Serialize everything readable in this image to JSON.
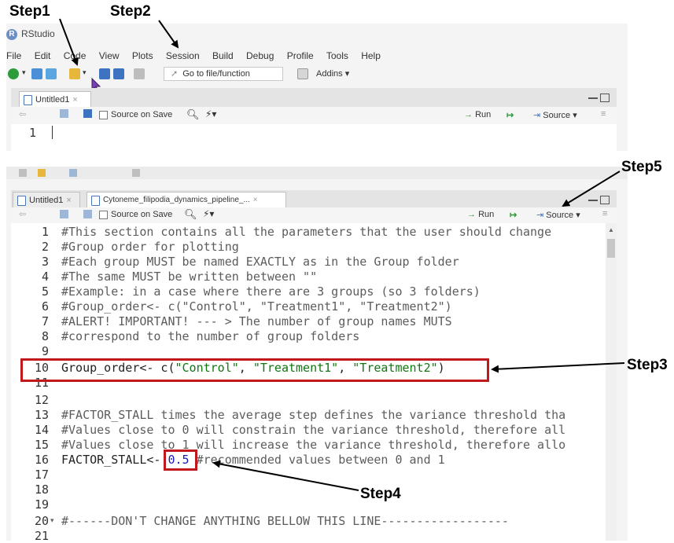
{
  "annotations": {
    "step1": "Step1",
    "step2": "Step2",
    "step3": "Step3",
    "step4": "Step4",
    "step5": "Step5"
  },
  "top_window": {
    "app_title": "RStudio",
    "menu": [
      "File",
      "Edit",
      "Code",
      "View",
      "Plots",
      "Session",
      "Build",
      "Debug",
      "Profile",
      "Tools",
      "Help"
    ],
    "goto_label": "Go to file/function",
    "addins_label": "Addins",
    "tab_label": "Untitled1",
    "source_on_save": "Source on Save",
    "run_label": "Run",
    "source_label": "Source",
    "line_number": "1"
  },
  "bottom_window": {
    "tabs": [
      {
        "label": "Untitled1"
      },
      {
        "label": "Cytoneme_filipodia_dynamics_pipeline_..."
      }
    ],
    "source_on_save": "Source on Save",
    "run_label": "Run",
    "source_label": "Source",
    "lines": [
      {
        "n": "1",
        "text": "#This section contains all the parameters that the user should change",
        "kind": "comment"
      },
      {
        "n": "2",
        "text": "#Group order for plotting",
        "kind": "comment"
      },
      {
        "n": "3",
        "text": "#Each group MUST be named EXACTLY as in the Group folder",
        "kind": "comment"
      },
      {
        "n": "4",
        "text": "#The same MUST be written between \"\"",
        "kind": "comment"
      },
      {
        "n": "5",
        "text": "#Example: in a case where there are 3 groups (so 3 folders)",
        "kind": "comment"
      },
      {
        "n": "6",
        "text": "#Group_order<- c(\"Control\", \"Treatment1\", \"Treatment2\")",
        "kind": "comment"
      },
      {
        "n": "7",
        "text": "#ALERT! IMPORTANT! --- > The number of group names MUTS",
        "kind": "comment"
      },
      {
        "n": "8",
        "text": "#correspond to the number of group folders",
        "kind": "comment"
      },
      {
        "n": "9",
        "text": "",
        "kind": "comment"
      },
      {
        "n": "10",
        "text": "Group_order<- c(\"Control\", \"Treatment1\", \"Treatment2\")",
        "kind": "code"
      },
      {
        "n": "11",
        "text": "",
        "kind": "comment"
      },
      {
        "n": "12",
        "text": "",
        "kind": "comment"
      },
      {
        "n": "13",
        "text": "#FACTOR_STALL times the average step defines the variance threshold tha",
        "kind": "comment"
      },
      {
        "n": "14",
        "text": "#Values close to 0 will constrain the variance threshold, therefore all",
        "kind": "comment"
      },
      {
        "n": "15",
        "text": "#Values close to 1 will increase the variance threshold, therefore allo",
        "kind": "comment"
      },
      {
        "n": "16",
        "text": "FACTOR_STALL<- 0.5 #recommended values between 0 and 1",
        "kind": "code"
      },
      {
        "n": "17",
        "text": "",
        "kind": "comment"
      },
      {
        "n": "18",
        "text": "",
        "kind": "comment"
      },
      {
        "n": "19",
        "text": "",
        "kind": "comment"
      },
      {
        "n": "20",
        "text": "#------DON'T CHANGE ANYTHING BELLOW THIS LINE------------------",
        "kind": "comment"
      },
      {
        "n": "21",
        "text": "",
        "kind": "comment"
      }
    ],
    "line10_parts": {
      "a": "Group_order<- c(",
      "s1": "\"Control\"",
      "sep1": ", ",
      "s2": "\"Treatment1\"",
      "sep2": ", ",
      "s3": "\"Treatment2\"",
      "end": ")"
    },
    "line16_parts": {
      "a": "FACTOR_STALL<- ",
      "num": "0.5",
      "rest": " #recommended values between 0 and 1"
    }
  },
  "colors": {
    "highlight_box": "#c0181c",
    "string": "#117711",
    "number": "#1b1bb3"
  }
}
